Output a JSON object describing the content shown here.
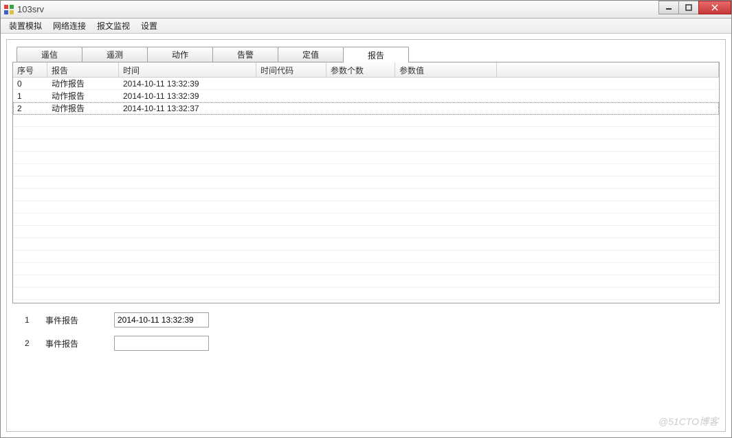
{
  "window": {
    "title": "103srv"
  },
  "menu": {
    "items": [
      "装置模拟",
      "网络连接",
      "报文监视",
      "设置"
    ]
  },
  "tabs": {
    "items": [
      "遥信",
      "遥测",
      "动作",
      "告警",
      "定值",
      "报告"
    ],
    "activeIndex": 5
  },
  "table": {
    "headers": {
      "seq": "序号",
      "report": "报告",
      "time": "时间",
      "timecode": "时间代码",
      "paramcount": "参数个数",
      "paramval": "参数值"
    },
    "rows": [
      {
        "seq": "0",
        "report": "动作报告",
        "time": "2014-10-11 13:32:39",
        "timecode": "",
        "paramcount": "",
        "paramval": ""
      },
      {
        "seq": "1",
        "report": "动作报告",
        "time": "2014-10-11 13:32:39",
        "timecode": "",
        "paramcount": "",
        "paramval": ""
      },
      {
        "seq": "2",
        "report": "动作报告",
        "time": "2014-10-11 13:32:37",
        "timecode": "",
        "paramcount": "",
        "paramval": ""
      }
    ],
    "selectedIndex": 2
  },
  "events": {
    "rows": [
      {
        "num": "1",
        "label": "事件报告",
        "value": "2014-10-11 13:32:39"
      },
      {
        "num": "2",
        "label": "事件报告",
        "value": ""
      }
    ]
  },
  "watermark": "@51CTO博客"
}
